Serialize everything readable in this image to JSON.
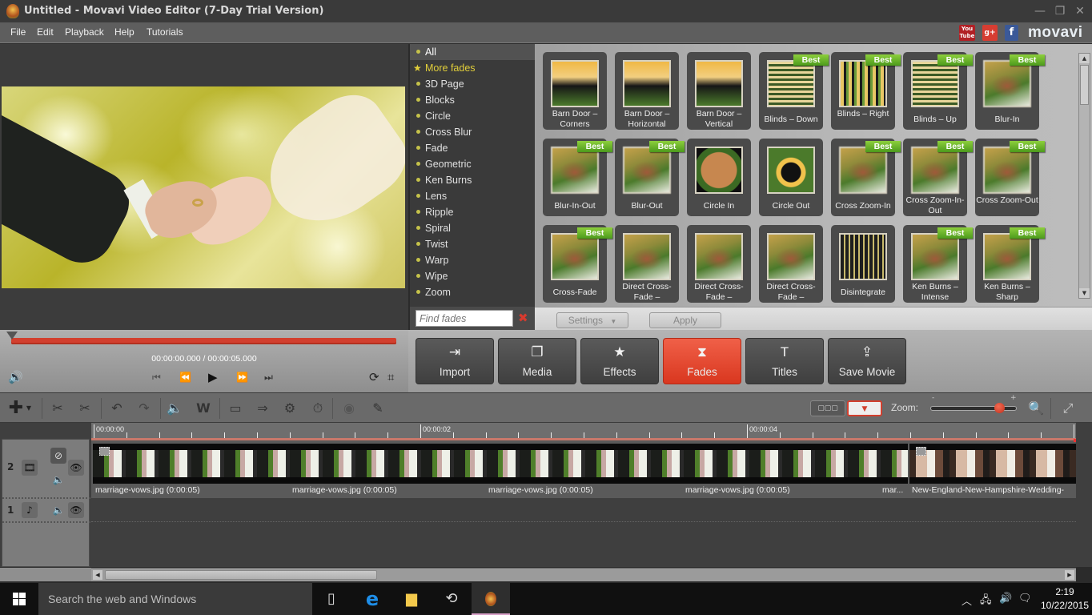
{
  "window": {
    "title": "Untitled - Movavi Video Editor (7-Day Trial Version)",
    "controls": {
      "minimize": "—",
      "restore": "❐",
      "close": "✕"
    }
  },
  "menu": {
    "items": [
      "File",
      "Edit",
      "Playback",
      "Help",
      "Tutorials"
    ],
    "social": [
      {
        "name": "youtube-icon",
        "label": "You Tube",
        "color": "#b12025"
      },
      {
        "name": "google-plus-icon",
        "label": "g+",
        "color": "#d73d32"
      },
      {
        "name": "facebook-icon",
        "label": "f",
        "color": "#3b5998"
      }
    ],
    "logo": "movavi"
  },
  "player": {
    "current_time": "00:00:00.000",
    "separator": "/",
    "total_time": "00:00:05.000",
    "progress_fraction": 0.0,
    "controls": {
      "volume": "🔊",
      "to_start": "⏮",
      "rewind": "⏪",
      "play": "▶",
      "forward": "⏩",
      "to_end": "⏭",
      "rotate": "⟳",
      "crop": "⌗"
    }
  },
  "categories": {
    "items": [
      {
        "label": "All",
        "active": true
      },
      {
        "label": "More fades",
        "more": true
      },
      {
        "label": "3D Page"
      },
      {
        "label": "Blocks"
      },
      {
        "label": "Circle"
      },
      {
        "label": "Cross Blur"
      },
      {
        "label": "Fade"
      },
      {
        "label": "Geometric"
      },
      {
        "label": "Ken Burns"
      },
      {
        "label": "Lens"
      },
      {
        "label": "Ripple"
      },
      {
        "label": "Spiral"
      },
      {
        "label": "Twist"
      },
      {
        "label": "Warp"
      },
      {
        "label": "Wipe"
      },
      {
        "label": "Zoom"
      }
    ],
    "search_placeholder": "Find fades",
    "clear_icon": "✖"
  },
  "gallery": {
    "best_label": "Best",
    "tiles": [
      {
        "label": "Barn Door – Corners",
        "best": false,
        "style": "dark"
      },
      {
        "label": "Barn Door – Horizontal",
        "best": false,
        "style": "dark"
      },
      {
        "label": "Barn Door – Vertical",
        "best": false,
        "style": "dark"
      },
      {
        "label": "Blinds – Down",
        "best": true,
        "style": "blinds"
      },
      {
        "label": "Blinds – Right",
        "best": true,
        "style": "vblinds"
      },
      {
        "label": "Blinds – Up",
        "best": true,
        "style": "blinds"
      },
      {
        "label": "Blur-In",
        "best": true,
        "style": "blurry"
      },
      {
        "label": "Blur-In-Out",
        "best": true,
        "style": "blurry"
      },
      {
        "label": "Blur-Out",
        "best": true,
        "style": "blurry"
      },
      {
        "label": "Circle In",
        "best": false,
        "style": "circle"
      },
      {
        "label": "Circle Out",
        "best": false,
        "style": "circleout"
      },
      {
        "label": "Cross Zoom-In",
        "best": true,
        "style": "blurry"
      },
      {
        "label": "Cross Zoom-In-Out",
        "best": true,
        "style": "blurry"
      },
      {
        "label": "Cross Zoom-Out",
        "best": true,
        "style": "blurry"
      },
      {
        "label": "Cross-Fade",
        "best": true,
        "style": ""
      },
      {
        "label": "Direct Cross-Fade –",
        "best": false,
        "style": ""
      },
      {
        "label": "Direct Cross-Fade –",
        "best": false,
        "style": ""
      },
      {
        "label": "Direct Cross-Fade –",
        "best": false,
        "style": ""
      },
      {
        "label": "Disintegrate",
        "best": false,
        "style": "disint"
      },
      {
        "label": "Ken Burns – Intense",
        "best": true,
        "style": ""
      },
      {
        "label": "Ken Burns – Sharp",
        "best": true,
        "style": ""
      }
    ],
    "settings_label": "Settings",
    "apply_label": "Apply"
  },
  "main_toolbar": {
    "buttons": [
      {
        "label": "Import",
        "icon": "⇥",
        "icon_name": "import-icon"
      },
      {
        "label": "Media",
        "icon": "❐",
        "icon_name": "media-icon"
      },
      {
        "label": "Effects",
        "icon": "★",
        "icon_name": "star-icon"
      },
      {
        "label": "Fades",
        "icon": "⧗",
        "icon_name": "hourglass-icon",
        "active": true
      },
      {
        "label": "Titles",
        "icon": "T",
        "icon_name": "text-icon"
      },
      {
        "label": "Save Movie",
        "icon": "⇪",
        "icon_name": "save-movie-icon"
      }
    ]
  },
  "edit_toolbar": {
    "zoom_label": "Zoom:",
    "zoom_minus": "-",
    "zoom_plus": "+",
    "zoom_level": 0.8
  },
  "timeline": {
    "ruler_labels": [
      "00:00:00",
      "00:00:02",
      "00:00:04"
    ],
    "tracks": [
      {
        "number": "2",
        "type": "video"
      },
      {
        "number": "1",
        "type": "audio"
      }
    ],
    "clips": [
      {
        "label": "marriage-vows.jpg (0:00:05)"
      },
      {
        "label": "marriage-vows.jpg (0:00:05)"
      },
      {
        "label": "marriage-vows.jpg (0:00:05)"
      },
      {
        "label": "marriage-vows.jpg (0:00:05)"
      },
      {
        "label": "mar..."
      },
      {
        "label": "New-England-New-Hampshire-Wedding-"
      }
    ]
  },
  "taskbar": {
    "search_placeholder": "Search the web and Windows",
    "time": "2:19",
    "date": "10/22/2015"
  }
}
